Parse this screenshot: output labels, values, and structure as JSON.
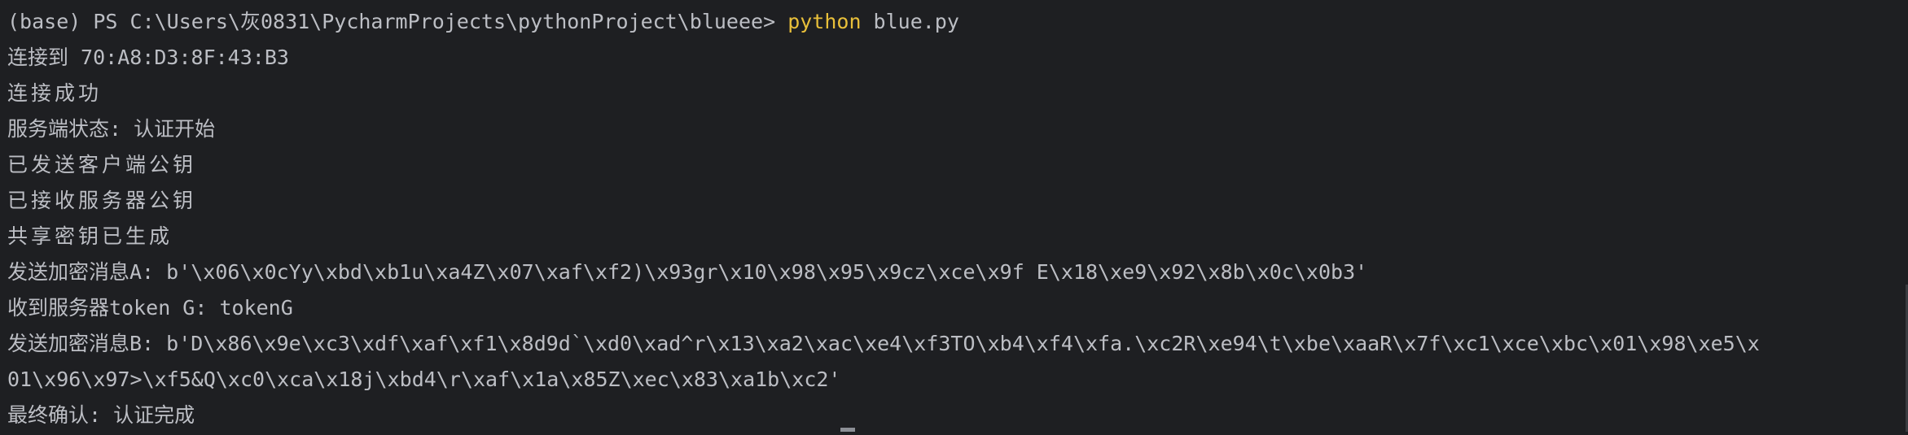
{
  "terminal": {
    "prompt": "(base) PS C:\\Users\\灰0831\\PycharmProjects\\pythonProject\\blueee> ",
    "command": "python",
    "command_args": " blue.py",
    "lines": [
      "连接到 70:A8:D3:8F:43:B3",
      "连接成功",
      "服务端状态: 认证开始",
      "已发送客户端公钥",
      "已接收服务器公钥",
      "共享密钥已生成",
      "发送加密消息A: b'\\x06\\x0cYy\\xbd\\xb1u\\xa4Z\\x07\\xaf\\xf2)\\x93gr\\x10\\x98\\x95\\x9cz\\xce\\x9f E\\x18\\xe9\\x92\\x8b\\x0c\\x0b3'",
      "收到服务器token G: tokenG",
      "发送加密消息B: b'D\\x86\\x9e\\xc3\\xdf\\xaf\\xf1\\x8d9d`\\xd0\\xad^r\\x13\\xa2\\xac\\xe4\\xf3TO\\xb4\\xf4\\xfa.\\xc2R\\xe94\\t\\xbe\\xaaR\\x7f\\xc1\\xce\\xbc\\x01\\x98\\xe5\\x",
      "01\\x96\\x97>\\xf5&Q\\xc0\\xca\\x18j\\xbd4\\r\\xaf\\x1a\\x85Z\\xec\\x83\\xa1b\\xc2'",
      "最终确认: 认证完成"
    ]
  }
}
